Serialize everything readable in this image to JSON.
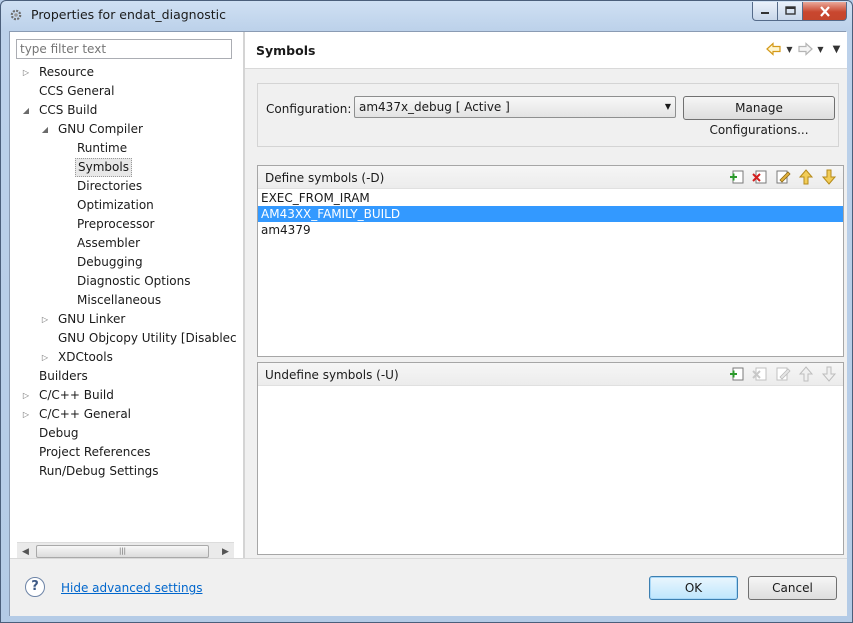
{
  "window": {
    "title": "Properties for endat_diagnostic",
    "app_icon": "gear-icon"
  },
  "filter": {
    "placeholder": "type filter text"
  },
  "tree": [
    {
      "label": "Resource",
      "indent": 0,
      "twisty": "collapsed"
    },
    {
      "label": "CCS General",
      "indent": 0,
      "twisty": "none"
    },
    {
      "label": "CCS Build",
      "indent": 0,
      "twisty": "expanded"
    },
    {
      "label": "GNU Compiler",
      "indent": 1,
      "twisty": "expanded"
    },
    {
      "label": "Runtime",
      "indent": 2,
      "twisty": "none"
    },
    {
      "label": "Symbols",
      "indent": 2,
      "twisty": "none",
      "selected": true
    },
    {
      "label": "Directories",
      "indent": 2,
      "twisty": "none"
    },
    {
      "label": "Optimization",
      "indent": 2,
      "twisty": "none"
    },
    {
      "label": "Preprocessor",
      "indent": 2,
      "twisty": "none"
    },
    {
      "label": "Assembler",
      "indent": 2,
      "twisty": "none"
    },
    {
      "label": "Debugging",
      "indent": 2,
      "twisty": "none"
    },
    {
      "label": "Diagnostic Options",
      "indent": 2,
      "twisty": "none"
    },
    {
      "label": "Miscellaneous",
      "indent": 2,
      "twisty": "none"
    },
    {
      "label": "GNU Linker",
      "indent": 1,
      "twisty": "collapsed"
    },
    {
      "label": "GNU Objcopy Utility  [Disablec",
      "indent": 1,
      "twisty": "none"
    },
    {
      "label": "XDCtools",
      "indent": 1,
      "twisty": "collapsed"
    },
    {
      "label": "Builders",
      "indent": 0,
      "twisty": "none"
    },
    {
      "label": "C/C++ Build",
      "indent": 0,
      "twisty": "collapsed"
    },
    {
      "label": "C/C++ General",
      "indent": 0,
      "twisty": "collapsed"
    },
    {
      "label": "Debug",
      "indent": 0,
      "twisty": "none"
    },
    {
      "label": "Project References",
      "indent": 0,
      "twisty": "none"
    },
    {
      "label": "Run/Debug Settings",
      "indent": 0,
      "twisty": "none"
    }
  ],
  "page": {
    "title": "Symbols"
  },
  "config": {
    "label": "Configuration:",
    "value": "am437x_debug  [ Active ]",
    "manage_label": "Manage Configurations..."
  },
  "define": {
    "title": "Define symbols (-D)",
    "items": [
      "EXEC_FROM_IRAM",
      "AM43XX_FAMILY_BUILD",
      "am4379"
    ],
    "selected_index": 1
  },
  "undefine": {
    "title": "Undefine symbols (-U)",
    "items": []
  },
  "footer": {
    "advanced_link": "Hide advanced settings",
    "ok_label": "OK",
    "cancel_label": "Cancel"
  }
}
